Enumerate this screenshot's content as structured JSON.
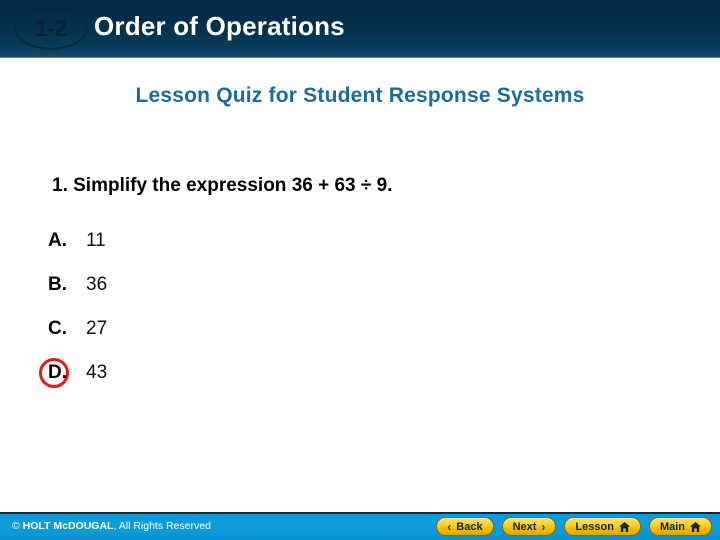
{
  "header": {
    "badge": "1-2",
    "title": "Order of Operations"
  },
  "subtitle": "Lesson Quiz for Student Response Systems",
  "question": {
    "number": "1.",
    "text": "1. Simplify the expression 36 + 63 ÷ 9."
  },
  "choices": [
    {
      "label": "A.",
      "value": "11",
      "selected": false
    },
    {
      "label": "B.",
      "value": "36",
      "selected": false
    },
    {
      "label": "C.",
      "value": "27",
      "selected": false
    },
    {
      "label": "D.",
      "value": "43",
      "selected": true
    }
  ],
  "footer": {
    "copyright_symbol": "©",
    "copyright_brand": "HOLT McDOUGAL",
    "copyright_rest": ", All Rights Reserved",
    "buttons": [
      {
        "label": "Back",
        "icon": "chevron-left-icon",
        "glyph": "‹",
        "icon_side": "left"
      },
      {
        "label": "Next",
        "icon": "chevron-right-icon",
        "glyph": "›",
        "icon_side": "right"
      },
      {
        "label": "Lesson",
        "icon": "home-icon",
        "glyph": "",
        "icon_side": "right"
      },
      {
        "label": "Main",
        "icon": "home-icon",
        "glyph": "",
        "icon_side": "right"
      }
    ]
  },
  "colors": {
    "header_navy": "#022744",
    "badge_gold": "#fbd043",
    "subtitle_blue": "#1a6e96",
    "footer_blue": "#0f9cdb",
    "highlight_red": "#e01b1b"
  }
}
